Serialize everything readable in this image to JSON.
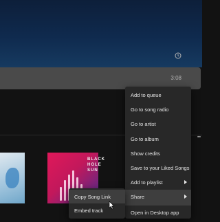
{
  "track": {
    "duration": "3:08"
  },
  "album": {
    "art_title": "BLACK HOLE SUN"
  },
  "context_menu": {
    "items": [
      {
        "label": "Add to queue",
        "has_submenu": false
      },
      {
        "label": "Go to song radio",
        "has_submenu": false
      },
      {
        "label": "Go to artist",
        "has_submenu": false
      },
      {
        "label": "Go to album",
        "has_submenu": false
      },
      {
        "label": "Show credits",
        "has_submenu": false
      },
      {
        "label": "Save to your Liked Songs",
        "has_submenu": false
      },
      {
        "label": "Add to playlist",
        "has_submenu": true
      },
      {
        "label": "Share",
        "has_submenu": true,
        "active": true
      },
      {
        "label": "Open in Desktop app",
        "has_submenu": false
      }
    ]
  },
  "share_submenu": {
    "items": [
      {
        "label": "Copy Song Link",
        "hovered": true
      },
      {
        "label": "Embed track"
      }
    ]
  },
  "colors": {
    "menu_bg": "#282828",
    "menu_highlight": "#3e3e3e",
    "track_row_bg": "#4a4a4a",
    "header_gradient": "#0f2a4e"
  },
  "icons": {
    "clock": "clock-icon",
    "cursor": "mouse-pointer-icon",
    "submenu": "chevron-right-icon"
  }
}
